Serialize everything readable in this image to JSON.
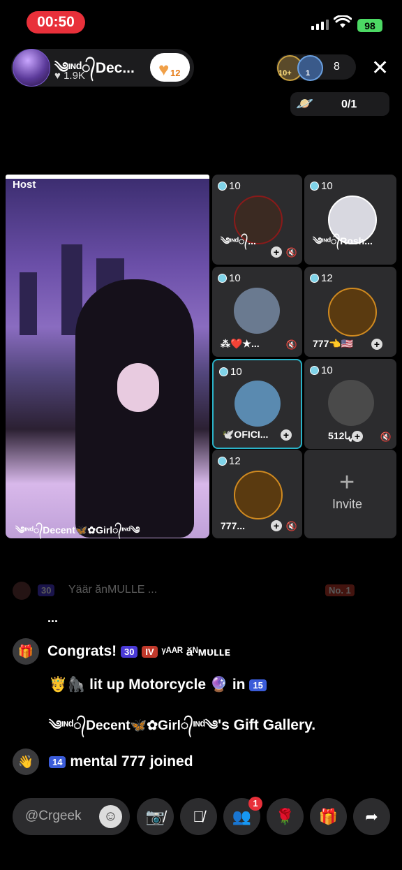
{
  "status_bar": {
    "time": "00:50",
    "battery": "98"
  },
  "host": {
    "name": "༄ᶦᶰᵈ᭄Dec...",
    "likes": "1.9K",
    "heart_level": "12"
  },
  "viewers": {
    "avatar1_level": "10+",
    "avatar2_level": "1",
    "count": "8"
  },
  "planet": {
    "score": "0/1"
  },
  "main_video": {
    "label": "Host",
    "caption": "༄ᶦᶰᵈ᭄Decent🦋✿Girl᭄ᶦᶰᵈ༄"
  },
  "guests": [
    {
      "level": "10",
      "name": "༄ᶦᶰᵈ᭄...",
      "color": "#3b2a22"
    },
    {
      "level": "10",
      "name": "༄ᶦᶰᵈ᭄Rosh...",
      "color": "#d8d8e0"
    },
    {
      "level": "10",
      "name": "⁂❤️★...",
      "color": "#6a7a90"
    },
    {
      "level": "12",
      "name": "777👈🇺🇸",
      "color": "#5a3a10"
    },
    {
      "level": "10",
      "name": "🕊️OFICI...",
      "color": "#5a8ab0"
    },
    {
      "level": "10",
      "name": "تنہا512",
      "color": "#4a4a4a"
    },
    {
      "level": "12",
      "name": "777...",
      "color": "#5a3a10"
    }
  ],
  "invite_label": "Invite",
  "chat": {
    "faded_text": "Yäär ănMULLE ...",
    "faded_badges": [
      "30",
      "No. 1"
    ],
    "ellipsis": "...",
    "congrats": {
      "prefix": "Congrats!",
      "badge1": "30",
      "badge2": "IV",
      "user": "ᵞᴬᴬᴿ ăᴺᴍᴜʟʟᴇ",
      "line2_emoji": "🤴🦍",
      "line2_text": "lit up Motorcycle",
      "in_word": "in",
      "badge3": "15",
      "line3_host": "༄ᶦᶰᵈ᭄Decent🦋✿Girl᭄ᶦᶰᵈ༄",
      "line3_suffix": "'s Gift Gallery."
    },
    "joined": {
      "badge": "14",
      "text": "mental 777 joined"
    }
  },
  "input": {
    "placeholder": "@Crgeek"
  },
  "controls": {
    "notification_count": "1"
  }
}
